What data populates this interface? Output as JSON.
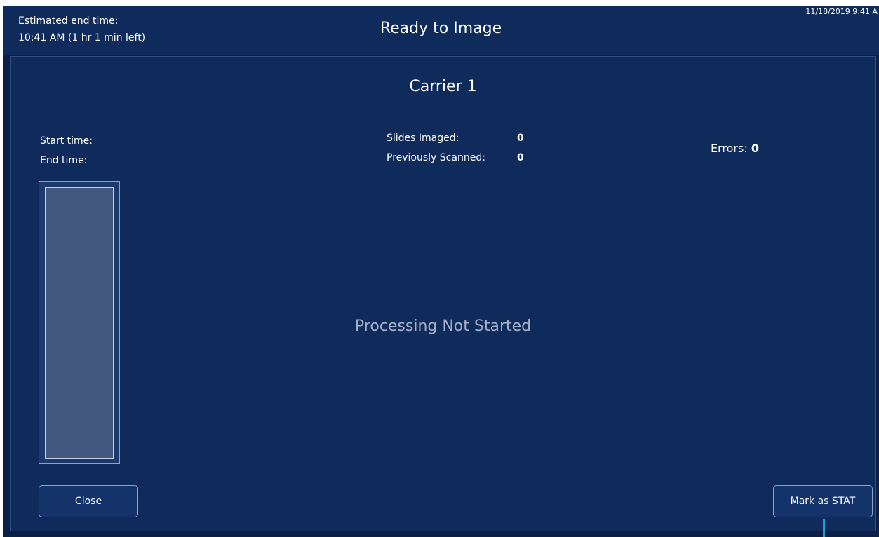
{
  "header": {
    "estimated_end_label": "Estimated end time:",
    "estimated_end_value": "10:41 AM (1 hr 1 min left)",
    "title": "Ready to Image",
    "datetime": "11/18/2019 9:41 A"
  },
  "carrier": {
    "title": "Carrier 1",
    "start_time_label": "Start time:",
    "end_time_label": "End time:",
    "slides_imaged_label": "Slides Imaged:",
    "slides_imaged_value": "0",
    "previously_scanned_label": "Previously Scanned:",
    "previously_scanned_value": "0",
    "errors_label": "Errors:",
    "errors_value": "0",
    "status_message": "Processing Not Started"
  },
  "buttons": {
    "close_label": "Close",
    "mark_stat_label": "Mark as STAT"
  },
  "colors": {
    "background": "#0c1f45",
    "panel": "#0f2b5c",
    "accent_indicator": "#1da1c8"
  }
}
